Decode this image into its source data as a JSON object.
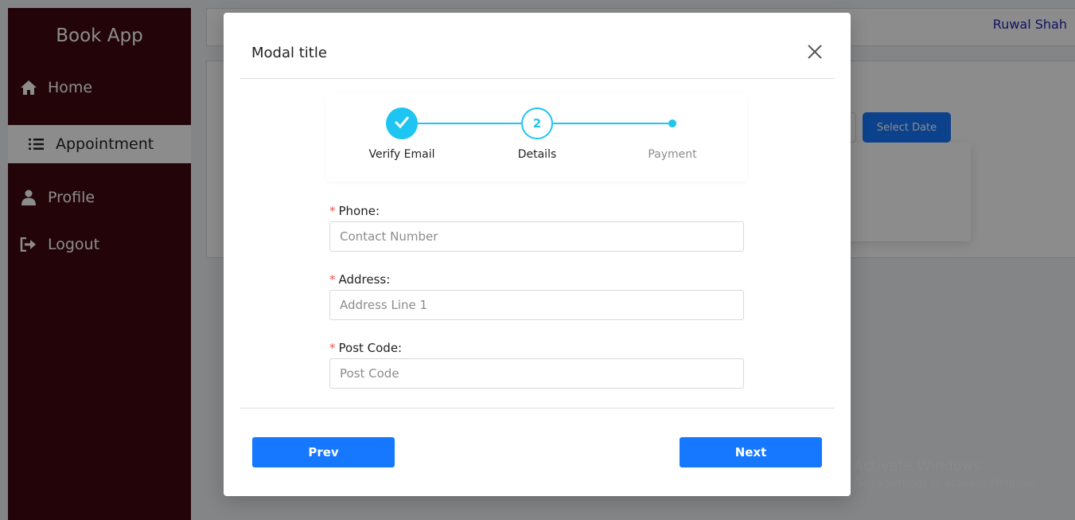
{
  "app": {
    "brand": "Book App",
    "user_name": "Ruwal Shah"
  },
  "sidebar": {
    "items": [
      {
        "label": "Home",
        "icon": "home-icon"
      },
      {
        "label": "Appointment",
        "icon": "list-icon",
        "active": true
      },
      {
        "label": "Profile",
        "icon": "user-icon"
      },
      {
        "label": "Logout",
        "icon": "logout-icon"
      }
    ]
  },
  "background": {
    "select_date_label": "Select Date"
  },
  "watermark": {
    "title": "Activate Windows",
    "subtitle": "Go to Settings to activate Windows."
  },
  "modal": {
    "title": "Modal title",
    "steps": [
      {
        "label": "Verify Email",
        "status": "done"
      },
      {
        "label": "Details",
        "status": "current",
        "number": "2"
      },
      {
        "label": "Payment",
        "status": "pending"
      }
    ],
    "fields": {
      "phone": {
        "label": "Phone:",
        "placeholder": "Contact Number",
        "required_mark": "*"
      },
      "address": {
        "label": "Address:",
        "placeholder": "Address Line 1",
        "required_mark": "*"
      },
      "post_code": {
        "label": "Post Code:",
        "placeholder": "Post Code",
        "required_mark": "*"
      }
    },
    "prev_label": "Prev",
    "next_label": "Next"
  },
  "colors": {
    "sidebar_bg": "#400a12",
    "primary": "#1677ff",
    "step_accent": "#1ec5f2",
    "required": "#ff4d4f",
    "user_name": "#1f1fb4"
  }
}
